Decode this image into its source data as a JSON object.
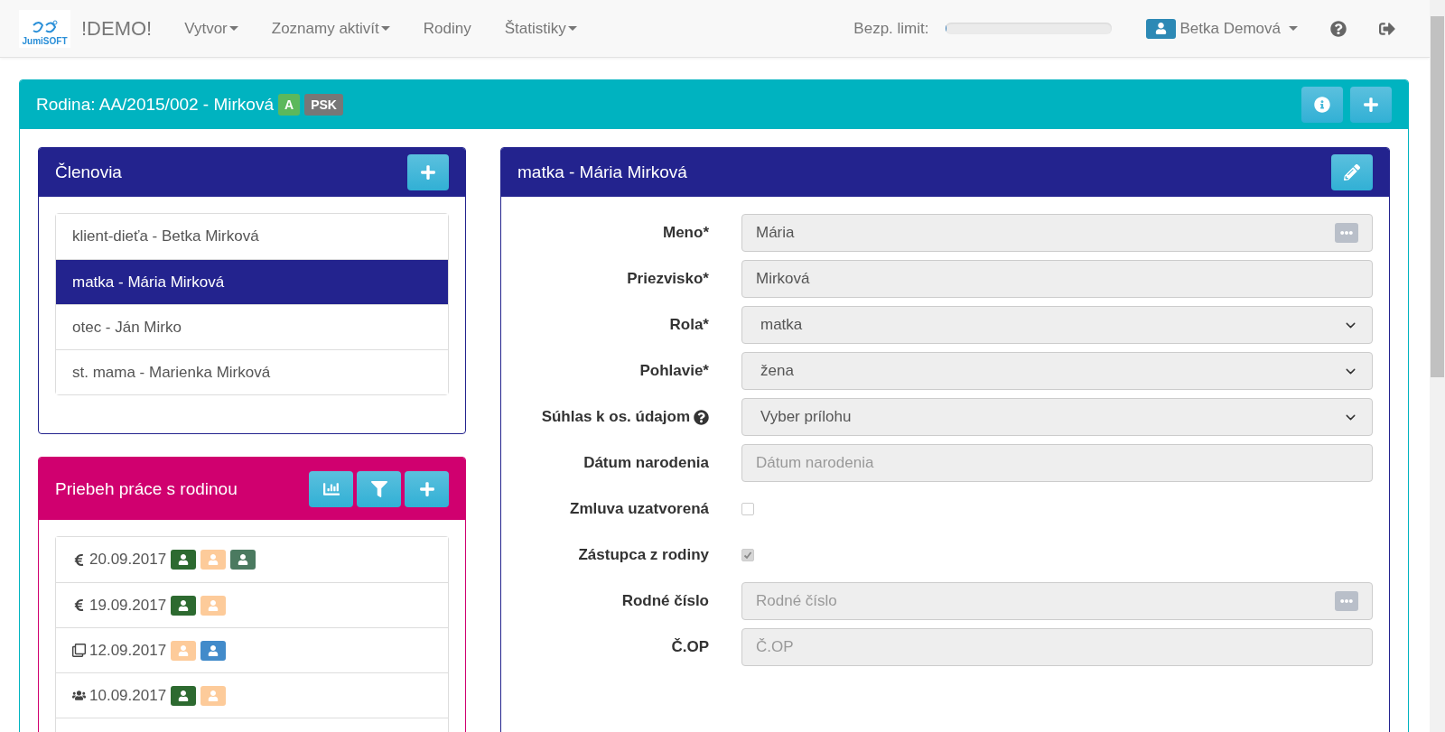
{
  "navbar": {
    "logo_text": "JumiSOFT",
    "brand": "!DEMO!",
    "menu": [
      {
        "label": "Vytvor",
        "dropdown": true
      },
      {
        "label": "Zoznamy aktivít",
        "dropdown": true
      },
      {
        "label": "Rodiny",
        "dropdown": false
      },
      {
        "label": "Štatistiky",
        "dropdown": true
      }
    ],
    "limit_label": "Bezp. limit:",
    "limit": {
      "level": 0.01
    },
    "user": "Betka Demová"
  },
  "family": {
    "title": "Rodina: AA/2015/002 - Mirková",
    "badges": [
      {
        "text": "A",
        "color": "#5cb85c"
      },
      {
        "text": "PSK",
        "color": "#777777"
      }
    ]
  },
  "members": {
    "title": "Členovia",
    "items": [
      {
        "label": "klient-dieťa - Betka Mirková",
        "selected": false
      },
      {
        "label": "matka - Mária Mirková",
        "selected": true
      },
      {
        "label": "otec - Ján Mirko",
        "selected": false
      },
      {
        "label": "st. mama - Marienka Mirková",
        "selected": false
      }
    ]
  },
  "progress": {
    "title": "Priebeh práce s rodinou",
    "items": [
      {
        "kind": "euro",
        "date": "20.09.2017",
        "badges": [
          {
            "color": "#2d6a30"
          },
          {
            "color": "#fdcb9a"
          },
          {
            "color": "#4b7a60"
          }
        ]
      },
      {
        "kind": "euro",
        "date": "19.09.2017",
        "badges": [
          {
            "color": "#2d6a30"
          },
          {
            "color": "#fdcb9a"
          }
        ]
      },
      {
        "kind": "copy",
        "date": "12.09.2017",
        "badges": [
          {
            "color": "#fdcb9a"
          },
          {
            "color": "#428bca"
          }
        ]
      },
      {
        "kind": "group",
        "date": "10.09.2017",
        "badges": [
          {
            "color": "#2d6a30"
          },
          {
            "color": "#fdcb9a"
          }
        ]
      }
    ]
  },
  "detail": {
    "title": "matka - Mária Mirková",
    "fields": [
      {
        "kind": "text",
        "label": "Meno*",
        "value": "Mária",
        "dots": true
      },
      {
        "kind": "text",
        "label": "Priezvisko*",
        "value": "Mirková"
      },
      {
        "kind": "select",
        "label": "Rola*",
        "value": "matka"
      },
      {
        "kind": "select",
        "label": "Pohlavie*",
        "value": "žena"
      },
      {
        "kind": "select",
        "label": "Súhlas k os. údajom",
        "help": true,
        "value": "Vyber prílohu"
      },
      {
        "kind": "text",
        "label": "Dátum narodenia",
        "placeholder": "Dátum narodenia"
      },
      {
        "kind": "checkbox",
        "label": "Zmluva uzatvorená",
        "checked": false
      },
      {
        "kind": "checkbox",
        "label": "Zástupca z rodiny",
        "checked": true
      },
      {
        "kind": "text",
        "label": "Rodné číslo",
        "placeholder": "Rodné číslo",
        "dots": true
      },
      {
        "kind": "text",
        "label": "Č.OP",
        "placeholder": "Č.OP"
      }
    ]
  }
}
